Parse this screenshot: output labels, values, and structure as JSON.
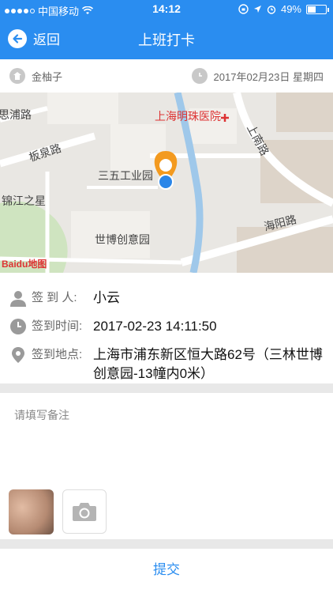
{
  "status_bar": {
    "carrier": "中国移动",
    "time": "14:12",
    "battery": "49%",
    "battery_level": 0.49,
    "signal_bars": 4
  },
  "nav": {
    "back_label": "返回",
    "title": "上班打卡"
  },
  "info": {
    "name": "金柚子",
    "date": "2017年02月23日 星期四"
  },
  "map": {
    "labels": {
      "road1": "思浦路",
      "road2": "板泉路",
      "hospital": "上海明珠医院",
      "road3": "上南路",
      "poi1": "三五工业园",
      "hotel": "锦江之星",
      "poi2": "世博创意园",
      "road4": "海阳路",
      "logo": "Baidu地图"
    }
  },
  "details": {
    "signer_label": "签  到  人:",
    "signer": "小云",
    "time_label": "签到时间:",
    "time": "2017-02-23 14:11:50",
    "location_label": "签到地点:",
    "location": "上海市浦东新区恒大路62号（三林世博创意园-13幢内0米）"
  },
  "remark": {
    "placeholder": "请填写备注",
    "value": ""
  },
  "submit_label": "提交",
  "colors": {
    "primary": "#2a8df0",
    "marker_orange": "#f39a1f",
    "marker_blue": "#2a86e8",
    "hospital_red": "#d33333"
  },
  "icons": {
    "back": "back-arrow-icon",
    "user": "user-icon",
    "clock": "clock-icon",
    "location": "location-pin-icon",
    "camera": "camera-icon"
  }
}
